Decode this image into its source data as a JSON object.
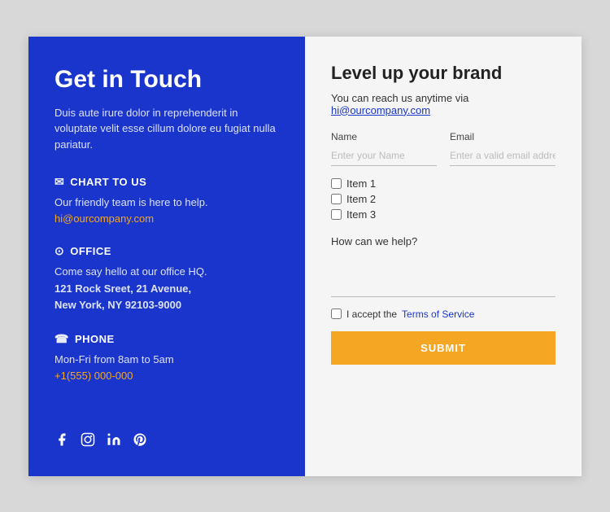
{
  "left": {
    "heading": "Get in Touch",
    "subtitle": "Duis aute irure dolor in reprehenderit in voluptate velit esse cillum dolore eu fugiat nulla pariatur.",
    "sections": [
      {
        "id": "chart",
        "icon": "✉",
        "title": "CHART TO US",
        "lines": [
          "Our friendly team is here to help."
        ],
        "link": "hi@ourcompany.com"
      },
      {
        "id": "office",
        "icon": "📍",
        "title": "OFFICE",
        "lines": [
          "Come say hello at our office HQ.",
          "121 Rock Sreet, 21 Avenue,",
          "New York, NY 92103-9000"
        ],
        "link": null
      },
      {
        "id": "phone",
        "icon": "📞",
        "title": "PHONE",
        "lines": [
          "Mon-Fri from 8am to 5am"
        ],
        "link": "+1(555) 000-000"
      }
    ],
    "social": [
      "f",
      "ig",
      "in",
      "p"
    ]
  },
  "right": {
    "heading": "Level up your brand",
    "reach_text": "You can reach us anytime via ",
    "reach_email": "hi@ourcompany.com",
    "name_label": "Name",
    "name_placeholder": "Enter your Name",
    "email_label": "Email",
    "email_placeholder": "Enter a valid email addres:",
    "checkboxes": [
      "Item 1",
      "Item 2",
      "Item 3"
    ],
    "how_help_label": "How can we help?",
    "tos_prefix": "I accept the ",
    "tos_link": "Terms of Service",
    "submit_label": "SUBMIT"
  }
}
